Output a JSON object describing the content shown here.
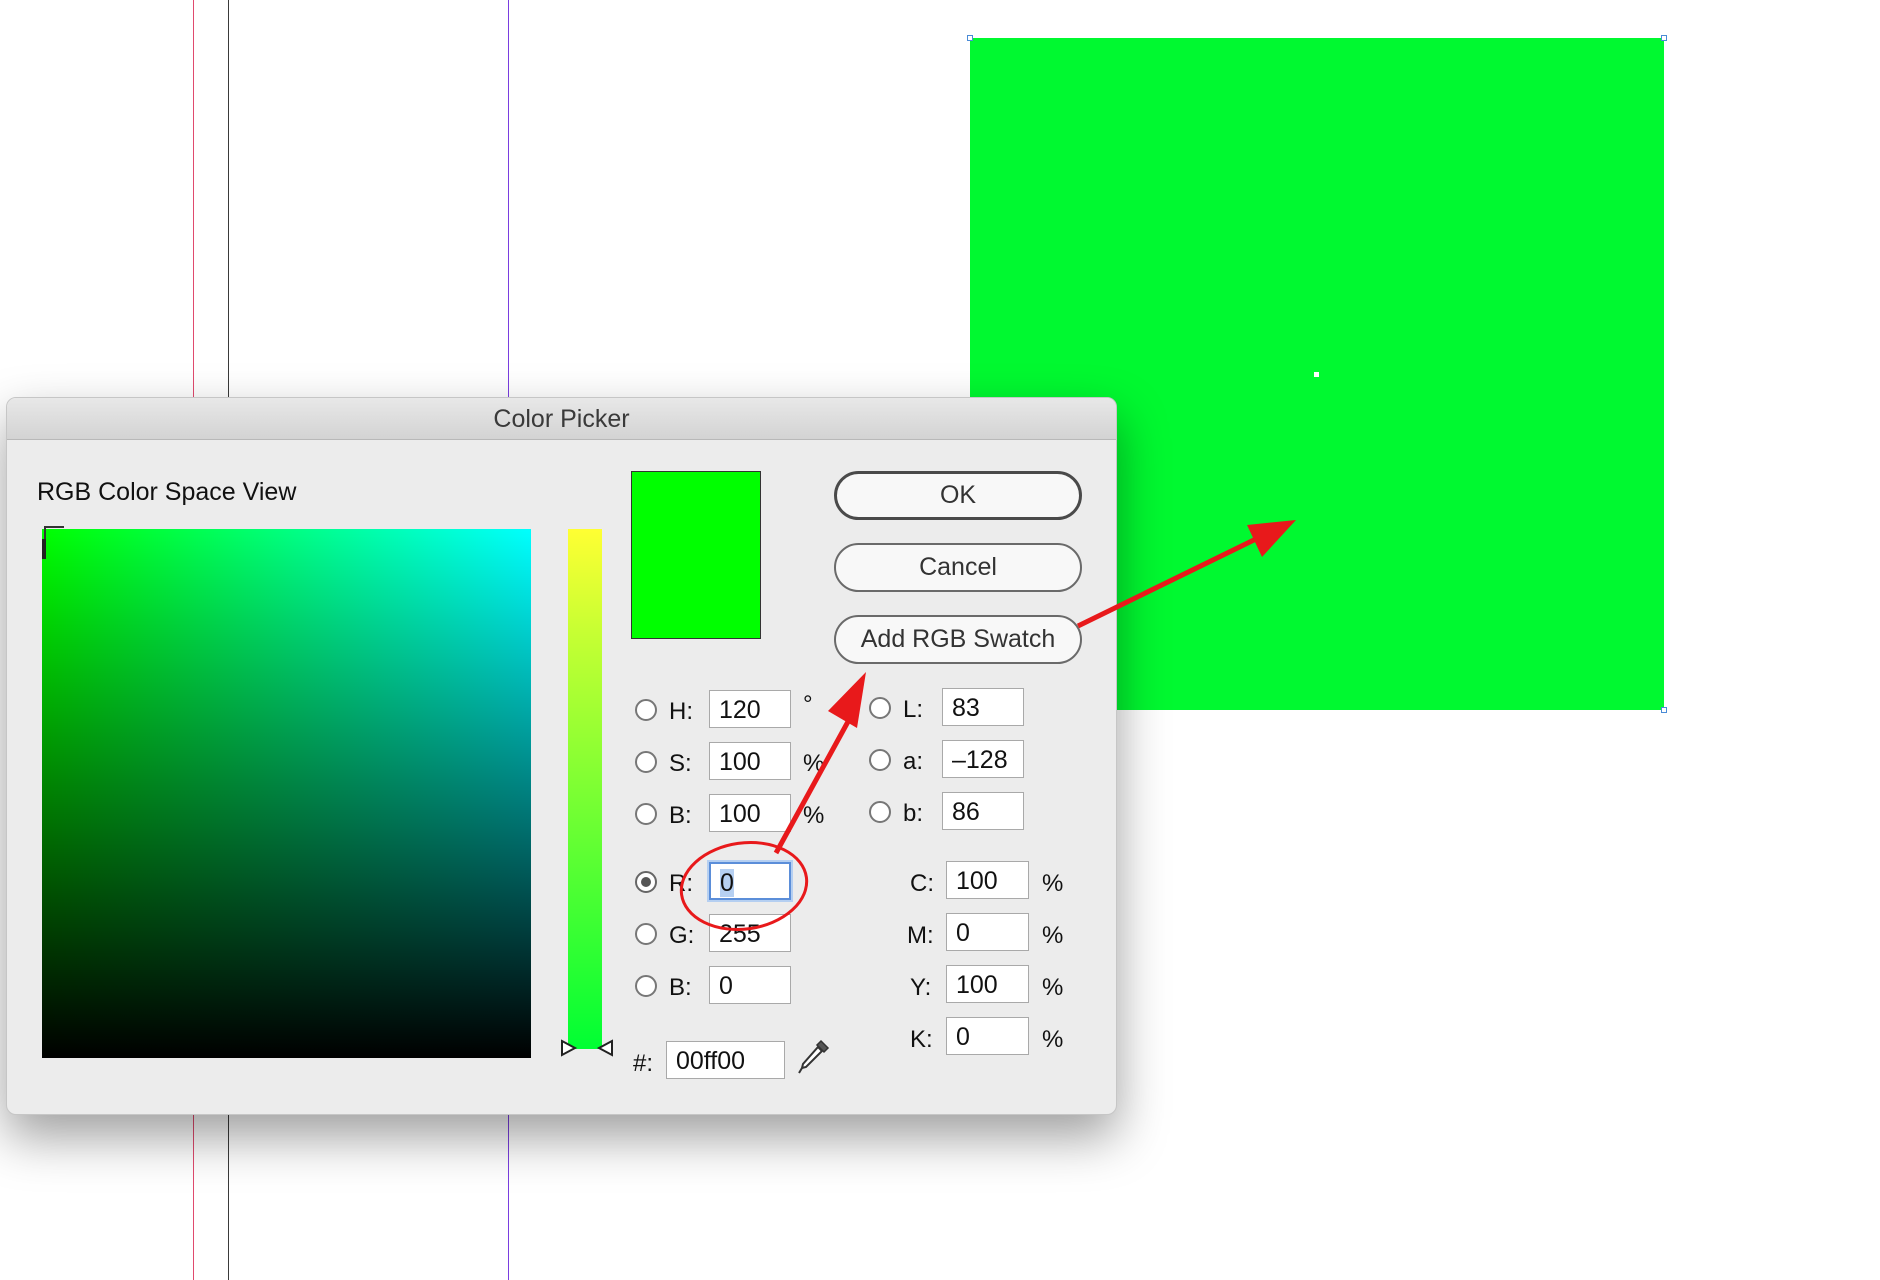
{
  "canvas": {
    "rect_color": "#00f930",
    "guide_colors": [
      "#e04a6e",
      "#3a3a3a",
      "#7a3ee0"
    ]
  },
  "dialog": {
    "title": "Color Picker",
    "space_view_label": "RGB Color Space View",
    "preview_color": "#00ff00",
    "buttons": {
      "ok": "OK",
      "cancel": "Cancel",
      "add_swatch": "Add RGB Swatch"
    },
    "hsb": {
      "h": {
        "label": "H:",
        "value": "120",
        "unit": "°"
      },
      "s": {
        "label": "S:",
        "value": "100",
        "unit": "%"
      },
      "b": {
        "label": "B:",
        "value": "100",
        "unit": "%"
      }
    },
    "rgb": {
      "r": {
        "label": "R:",
        "value": "0"
      },
      "g": {
        "label": "G:",
        "value": "255"
      },
      "b": {
        "label": "B:",
        "value": "0"
      }
    },
    "lab": {
      "l": {
        "label": "L:",
        "value": "83"
      },
      "a": {
        "label": "a:",
        "value": "–128"
      },
      "b": {
        "label": "b:",
        "value": "86"
      }
    },
    "cmyk": {
      "c": {
        "label": "C:",
        "value": "100",
        "unit": "%"
      },
      "m": {
        "label": "M:",
        "value": "0",
        "unit": "%"
      },
      "y": {
        "label": "Y:",
        "value": "100",
        "unit": "%"
      },
      "k": {
        "label": "K:",
        "value": "0",
        "unit": "%"
      }
    },
    "hex": {
      "label": "#:",
      "value": "00ff00"
    },
    "selected_mode": "R"
  },
  "annotation_color": "#e8191b"
}
